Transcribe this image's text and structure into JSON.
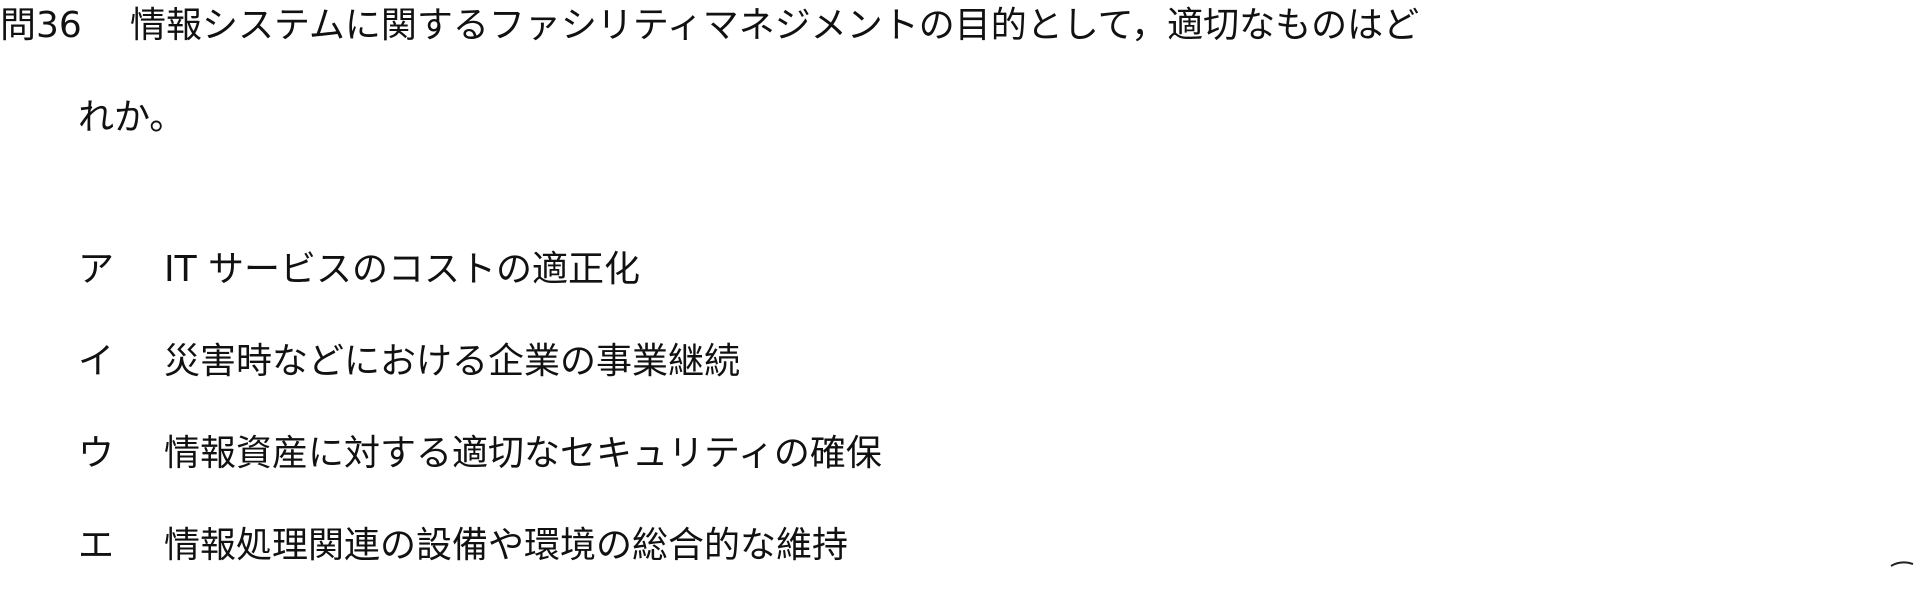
{
  "question": {
    "number": "問36",
    "text_line1": "情報システムに関するファシリティマネジメントの目的として，適切なものはど",
    "text_line2": "れか。"
  },
  "choices": [
    {
      "mark": "ア",
      "text": "IT サービスのコストの適正化"
    },
    {
      "mark": "イ",
      "text": "災害時などにおける企業の事業継続"
    },
    {
      "mark": "ウ",
      "text": "情報資産に対する適切なセキュリティの確保"
    },
    {
      "mark": "エ",
      "text": "情報処理関連の設備や環境の総合的な維持"
    }
  ]
}
